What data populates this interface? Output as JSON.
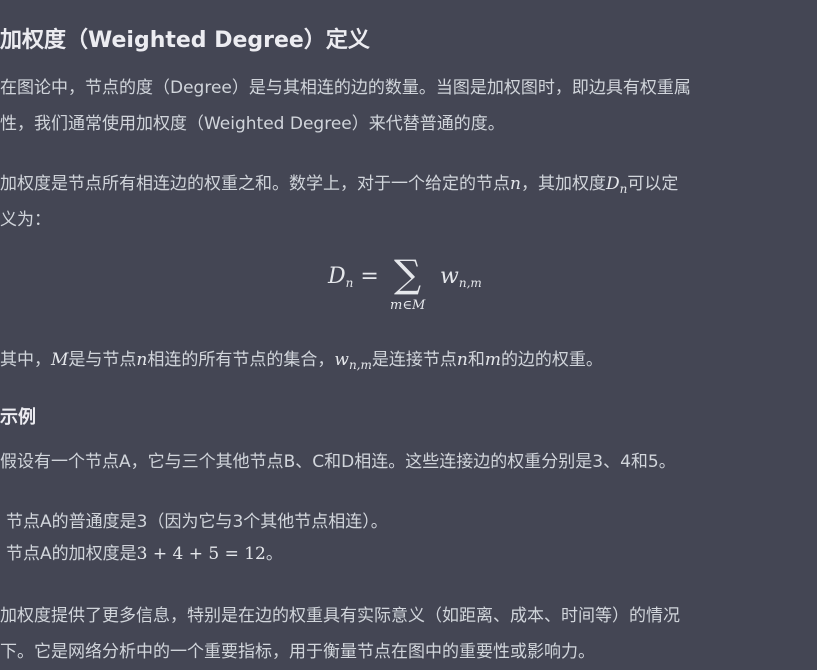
{
  "title": "加权度（Weighted Degree）定义",
  "intro": {
    "line1": "在图论中，节点的度（Degree）是与其相连的边的数量。当图是加权图时，即边具有权重属",
    "line2": "性，我们通常使用加权度（Weighted Degree）来代替普通的度。"
  },
  "definition": {
    "line1_part1": "加权度是节点所有相连边的权重之和。数学上，对于一个给定的节点",
    "var_n": "n",
    "line1_part2": "，其加权度",
    "var_D": "D",
    "sub_n": "n",
    "line1_part3": "可以定",
    "line2": "义为："
  },
  "formula": {
    "lhs_D": "D",
    "lhs_sub": "n",
    "eq": " = ",
    "sigma": "∑",
    "under": "m∈M",
    "term_w": "w",
    "term_sub": "n,m"
  },
  "where": {
    "p1": "其中，",
    "M": "M",
    "p2": "是与节点",
    "n": "n",
    "p3": "相连的所有节点的集合，",
    "w": "w",
    "w_sub": "n,m",
    "p4": "是连接节点",
    "n2": "n",
    "p5": "和",
    "m": "m",
    "p6": "的边的权重。"
  },
  "example": {
    "heading": "示例",
    "text": "假设有一个节点A，它与三个其他节点B、C和D相连。这些连接边的权重分别是3、4和5。",
    "bullet1": "节点A的普通度是3（因为它与3个其他节点相连）。",
    "bullet2_text": "节点A的加权度是",
    "bullet2_math": "3 + 4 + 5 = 12",
    "bullet2_end": "。"
  },
  "conclusion": {
    "line1": "加权度提供了更多信息，特别是在边的权重具有实际意义（如距离、成本、时间等）的情况",
    "line2": "下。它是网络分析中的一个重要指标，用于衡量节点在图中的重要性或影响力。"
  }
}
